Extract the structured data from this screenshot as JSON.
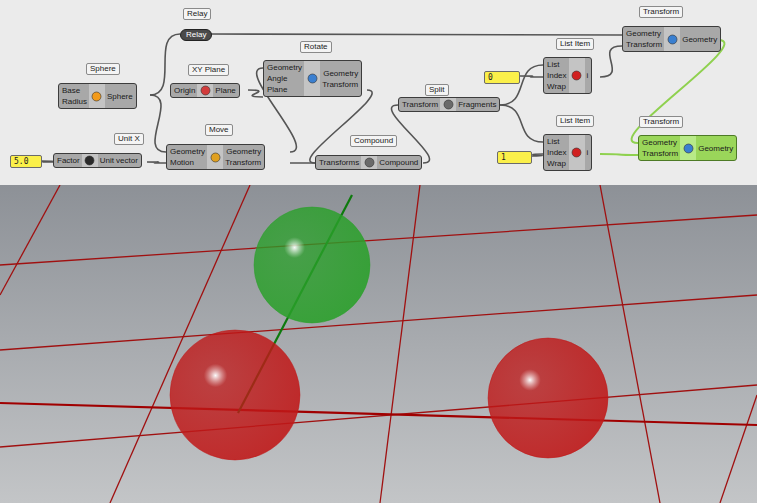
{
  "canvas": {
    "nodes": [
      {
        "tag": "Sphere",
        "kind": "component",
        "inputs": [
          "Base",
          "Radius"
        ],
        "outputs": [
          "Sphere"
        ],
        "selected": false
      },
      {
        "tag": "XY Plane",
        "kind": "component",
        "inputs": [
          "Origin"
        ],
        "outputs": [
          "Plane"
        ],
        "selected": false
      },
      {
        "tag": "Rotate",
        "kind": "component",
        "inputs": [
          "Geometry",
          "Angle",
          "Plane"
        ],
        "outputs": [
          "Geometry",
          "Transform"
        ],
        "selected": false
      },
      {
        "tag": "Unit X",
        "kind": "component",
        "inputs": [
          "Factor"
        ],
        "outputs": [
          "Unit vector"
        ],
        "selected": false
      },
      {
        "tag": "Move",
        "kind": "component",
        "inputs": [
          "Geometry",
          "Motion"
        ],
        "outputs": [
          "Geometry",
          "Transform"
        ],
        "selected": false
      },
      {
        "tag": "Compound",
        "kind": "component",
        "inputs": [
          "Transforms"
        ],
        "outputs": [
          "Compound"
        ],
        "selected": false
      },
      {
        "tag": "Split",
        "kind": "component",
        "inputs": [
          "Transform"
        ],
        "outputs": [
          "Fragments"
        ],
        "selected": false
      },
      {
        "tag": "List Item",
        "kind": "component",
        "inputs": [
          "List",
          "Index",
          "Wrap"
        ],
        "outputs": [
          "i"
        ],
        "selected": false
      },
      {
        "tag": "List Item",
        "kind": "component",
        "inputs": [
          "List",
          "Index",
          "Wrap"
        ],
        "outputs": [
          "i"
        ],
        "selected": false
      },
      {
        "tag": "Transform",
        "kind": "component",
        "inputs": [
          "Geometry",
          "Transform"
        ],
        "outputs": [
          "Geometry"
        ],
        "selected": false
      },
      {
        "tag": "Transform",
        "kind": "component",
        "inputs": [
          "Geometry",
          "Transform"
        ],
        "outputs": [
          "Geometry"
        ],
        "selected": true
      },
      {
        "tag": "Relay",
        "kind": "relay",
        "label": "Relay",
        "selected": false
      }
    ],
    "sliders": [
      {
        "value": "5.0"
      },
      {
        "value": "0"
      },
      {
        "value": "1"
      }
    ]
  },
  "viewport": {
    "spheres": [
      {
        "color": "#c01818"
      },
      {
        "color": "#c01818"
      },
      {
        "color": "#2aa02a"
      }
    ]
  }
}
